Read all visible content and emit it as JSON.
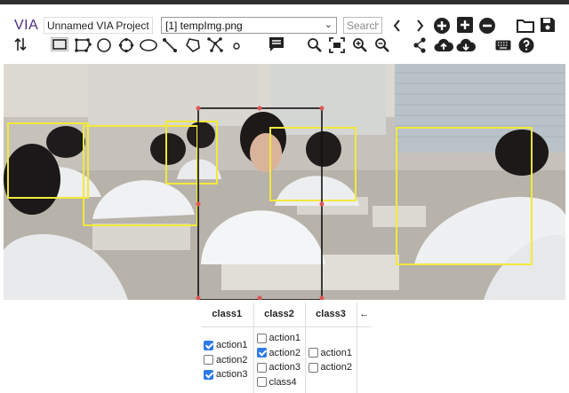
{
  "app": {
    "brand": "VIA",
    "project_name": "Unnamed VIA Project"
  },
  "file_selector": {
    "selected": "[1] tempImg.png"
  },
  "search": {
    "placeholder": "Search"
  },
  "toolbar_icons": [
    "previous-image-icon",
    "next-image-icon",
    "add-files-icon",
    "add-url-icon",
    "remove-file-icon",
    "open-project-icon",
    "save-project-icon",
    "sort-icon",
    "rect-shape-icon",
    "polygon-shape-icon",
    "circle-shape-icon",
    "ring-shape-icon",
    "ellipse-shape-icon",
    "line-shape-icon",
    "polygon-outline-icon",
    "polyline-shape-icon",
    "point-shape-icon",
    "annotation-editor-icon",
    "zoom-icon",
    "fit-screen-icon",
    "zoom-in-icon",
    "zoom-out-icon",
    "share-icon",
    "cloud-upload-icon",
    "cloud-download-icon",
    "keyboard-icon",
    "help-icon"
  ],
  "colors": {
    "brand": "#4a2f7c",
    "region_box": "#f2e93c",
    "selected_region_box": "#111111",
    "region_handle": "#e05555",
    "checkbox_checked": "#2e7ae6",
    "back_arrow": "#2a62c9"
  },
  "attributes": {
    "columns": [
      {
        "header": "class1",
        "options": [
          {
            "label": "action1",
            "checked": true
          },
          {
            "label": "action2",
            "checked": false
          },
          {
            "label": "action3",
            "checked": true
          }
        ]
      },
      {
        "header": "class2",
        "options": [
          {
            "label": "action1",
            "checked": false
          },
          {
            "label": "action2",
            "checked": true
          },
          {
            "label": "action3",
            "checked": false
          },
          {
            "label": "class4",
            "checked": false
          }
        ]
      },
      {
        "header": "class3",
        "options": [
          {
            "label": "action1",
            "checked": false
          },
          {
            "label": "action2",
            "checked": false
          }
        ]
      }
    ],
    "back_arrow": "←"
  }
}
